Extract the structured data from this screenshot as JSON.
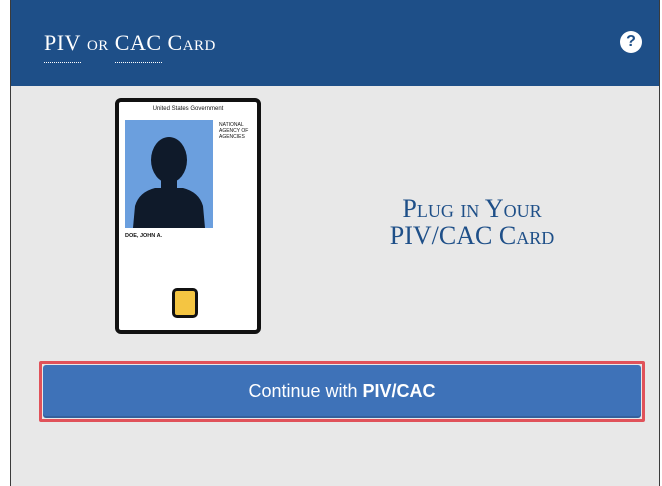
{
  "header": {
    "title_abbr1": "PIV",
    "title_mid": "or",
    "title_abbr2": "CAC",
    "title_tail": "Card",
    "help_icon_glyph": "?"
  },
  "card_illustration": {
    "government_label": "United States Government",
    "agency_label": "NATIONAL AGENCY OF AGENCIES",
    "name_label": "DOE, JOHN A.",
    "photo_color": "#6b9fde",
    "chip_color": "#f4c542"
  },
  "prompt": {
    "line1": "Plug in Your",
    "line2": "PIV/CAC Card"
  },
  "continue_button": {
    "label_prefix": "Continue with ",
    "label_bold": "PIV/CAC",
    "color": "#3e72b8",
    "highlight_color": "#e0525a"
  },
  "colors": {
    "header_bg": "#1e4f88",
    "panel_bg": "#e8e8e8"
  }
}
